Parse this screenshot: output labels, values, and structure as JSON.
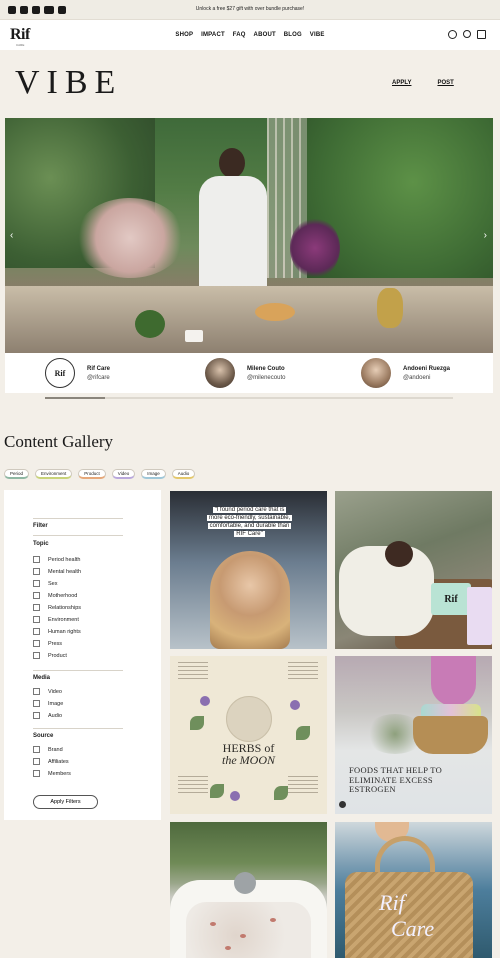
{
  "announcement": "Unlock a free $27 gift with over bundle purchase!",
  "brand": {
    "logo": "Rif",
    "logo_sub": "CARE"
  },
  "nav": [
    "SHOP",
    "IMPACT",
    "FAQ",
    "ABOUT",
    "BLOG",
    "VIBE"
  ],
  "page_title": "VIBE",
  "header_links": {
    "apply": "APPLY",
    "post": "POST"
  },
  "hero": {
    "prev": "‹",
    "next": "›"
  },
  "profiles": [
    {
      "name": "Rif Care",
      "handle": "@rifcare",
      "avatar_text": "Rif"
    },
    {
      "name": "Milene Couto",
      "handle": "@milenecouto"
    },
    {
      "name": "Andoeni Ruezga",
      "handle": "@andoeni"
    }
  ],
  "gallery": {
    "title": "Content Gallery",
    "chips": [
      "Period",
      "Environment",
      "Product",
      "Video",
      "Image",
      "Audio"
    ]
  },
  "filter": {
    "title": "Filter",
    "topic": {
      "heading": "Topic",
      "options": [
        "Period health",
        "Mental health",
        "Sex",
        "Motherhood",
        "Relationships",
        "Environment",
        "Human rights",
        "Press",
        "Product"
      ]
    },
    "media": {
      "heading": "Media",
      "options": [
        "Video",
        "Image",
        "Audio"
      ]
    },
    "source": {
      "heading": "Source",
      "options": [
        "Brand",
        "Affiliates",
        "Members"
      ]
    },
    "apply_label": "Apply Filters"
  },
  "tiles": {
    "quote": "\"I found period care that is more eco-friendly, sustainable, comfortable, and durable than RIF Care\"",
    "herbs_line1": "HERBS of",
    "herbs_line2": "the MOON",
    "foods_caption": "FOODS THAT HELP TO ELIMINATE EXCESS ESTROGEN",
    "pack_label": "Rif",
    "bag_line1": "Rif",
    "bag_line2": "Care"
  }
}
